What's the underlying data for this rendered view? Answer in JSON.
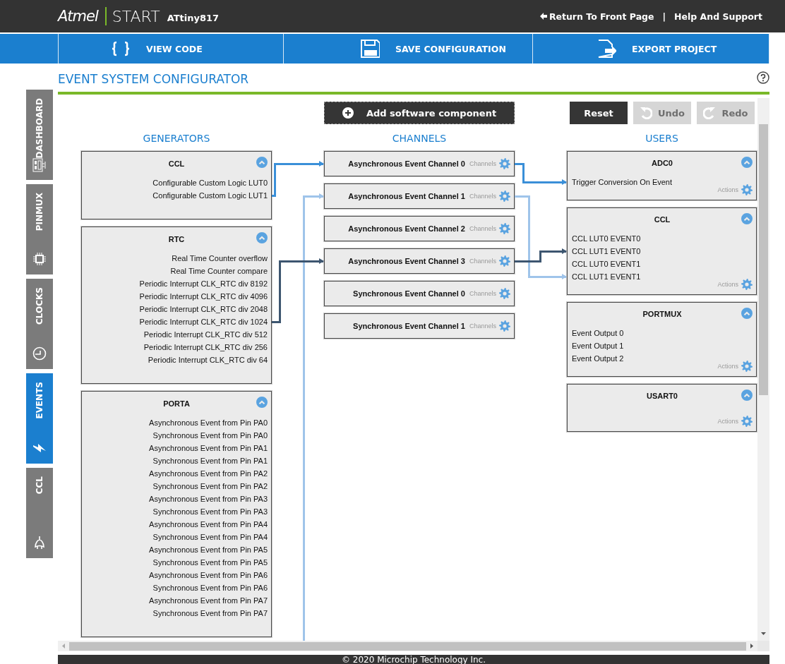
{
  "header": {
    "logo": "Atmel",
    "product": "START",
    "device": "ATtiny817",
    "links": [
      "Return To Front Page",
      "Help And Support"
    ],
    "separator": "|"
  },
  "toolbar": [
    {
      "kind": "code",
      "label": "VIEW CODE"
    },
    {
      "kind": "save",
      "label": "SAVE CONFIGURATION"
    },
    {
      "kind": "export",
      "label": "EXPORT PROJECT"
    }
  ],
  "page_title": "EVENT SYSTEM CONFIGURATOR",
  "sidebar": [
    {
      "kind": "dashboard",
      "label": "DASHBOARD",
      "selected": false
    },
    {
      "kind": "pinmux",
      "label": "PINMUX",
      "selected": false
    },
    {
      "kind": "clocks",
      "label": "CLOCKS",
      "selected": false
    },
    {
      "kind": "events",
      "label": "EVENTS",
      "selected": true
    },
    {
      "kind": "ccl",
      "label": "CCL",
      "selected": false
    }
  ],
  "add_button": "Add software component",
  "buttons": [
    {
      "kind": "reset",
      "label": "Reset",
      "disabled": false
    },
    {
      "kind": "undo",
      "label": "Undo",
      "disabled": true
    },
    {
      "kind": "redo",
      "label": "Redo",
      "disabled": true
    }
  ],
  "columns": [
    "GENERATORS",
    "CHANNELS",
    "USERS"
  ],
  "generators": [
    {
      "title": "CCL",
      "items": [
        {
          "label": "Configurable Custom Logic LUT0"
        },
        {
          "label": "Configurable Custom Logic LUT1",
          "color": "#3a8fd8"
        }
      ]
    },
    {
      "title": "RTC",
      "items": [
        {
          "label": "Real Time Counter overflow"
        },
        {
          "label": "Real Time Counter compare"
        },
        {
          "label": "Periodic Interrupt CLK_RTC div 8192"
        },
        {
          "label": "Periodic Interrupt CLK_RTC div 4096"
        },
        {
          "label": "Periodic Interrupt CLK_RTC div 2048"
        },
        {
          "label": "Periodic Interrupt CLK_RTC div 1024",
          "color": "#3d5670"
        },
        {
          "label": "Periodic Interrupt CLK_RTC div 512"
        },
        {
          "label": "Periodic Interrupt CLK_RTC div 256"
        },
        {
          "label": "Periodic Interrupt CLK_RTC div 64"
        }
      ]
    },
    {
      "title": "PORTA",
      "items": [
        {
          "label": "Asynchronous Event from Pin PA0"
        },
        {
          "label": "Synchronous Event from Pin PA0"
        },
        {
          "label": "Asynchronous Event from Pin PA1"
        },
        {
          "label": "Synchronous Event from Pin PA1"
        },
        {
          "label": "Asynchronous Event from Pin PA2"
        },
        {
          "label": "Synchronous Event from Pin PA2"
        },
        {
          "label": "Asynchronous Event from Pin PA3"
        },
        {
          "label": "Synchronous Event from Pin PA3"
        },
        {
          "label": "Asynchronous Event from Pin PA4"
        },
        {
          "label": "Synchronous Event from Pin PA4"
        },
        {
          "label": "Asynchronous Event from Pin PA5"
        },
        {
          "label": "Synchronous Event from Pin PA5"
        },
        {
          "label": "Asynchronous Event from Pin PA6"
        },
        {
          "label": "Synchronous Event from Pin PA6"
        },
        {
          "label": "Asynchronous Event from Pin PA7"
        },
        {
          "label": "Synchronous Event from Pin PA7"
        }
      ]
    },
    {
      "color": "#9fc4ea"
    }
  ],
  "channels": [
    {
      "name": "Asynchronous Event Channel 0",
      "hint": "Channels",
      "color": "#3a8fd8"
    },
    {
      "name": "Asynchronous Event Channel 1",
      "hint": "Channels",
      "color": "#9fc4ea"
    },
    {
      "name": "Asynchronous Event Channel 2",
      "hint": "Channels"
    },
    {
      "name": "Asynchronous Event Channel 3",
      "hint": "Channels",
      "color": "#3d5670"
    },
    {
      "name": "Synchronous Event Channel 0",
      "hint": "Channels"
    },
    {
      "name": "Synchronous Event Channel 1",
      "hint": "Channels"
    }
  ],
  "users": [
    {
      "title": "ADC0",
      "items": [
        {
          "label": "Trigger Conversion On Event",
          "color": "#3a8fd8"
        }
      ],
      "hint": "Actions"
    },
    {
      "title": "CCL",
      "items": [
        {
          "label": "CCL LUT0 EVENT0"
        },
        {
          "label": "CCL LUT1 EVENT0",
          "color": "#3d5670"
        },
        {
          "label": "CCL LUT0 EVENT1"
        },
        {
          "label": "CCL LUT1 EVENT1",
          "color": "#9fc4ea"
        }
      ],
      "hint": "Actions"
    },
    {
      "title": "PORTMUX",
      "items": [
        {
          "label": "Event Output 0"
        },
        {
          "label": "Event Output 1"
        },
        {
          "label": "Event Output 2"
        }
      ],
      "hint": "Actions"
    },
    {
      "title": "USART0",
      "hint": "Actions"
    }
  ],
  "footer": "© 2020 Microchip Technology Inc."
}
